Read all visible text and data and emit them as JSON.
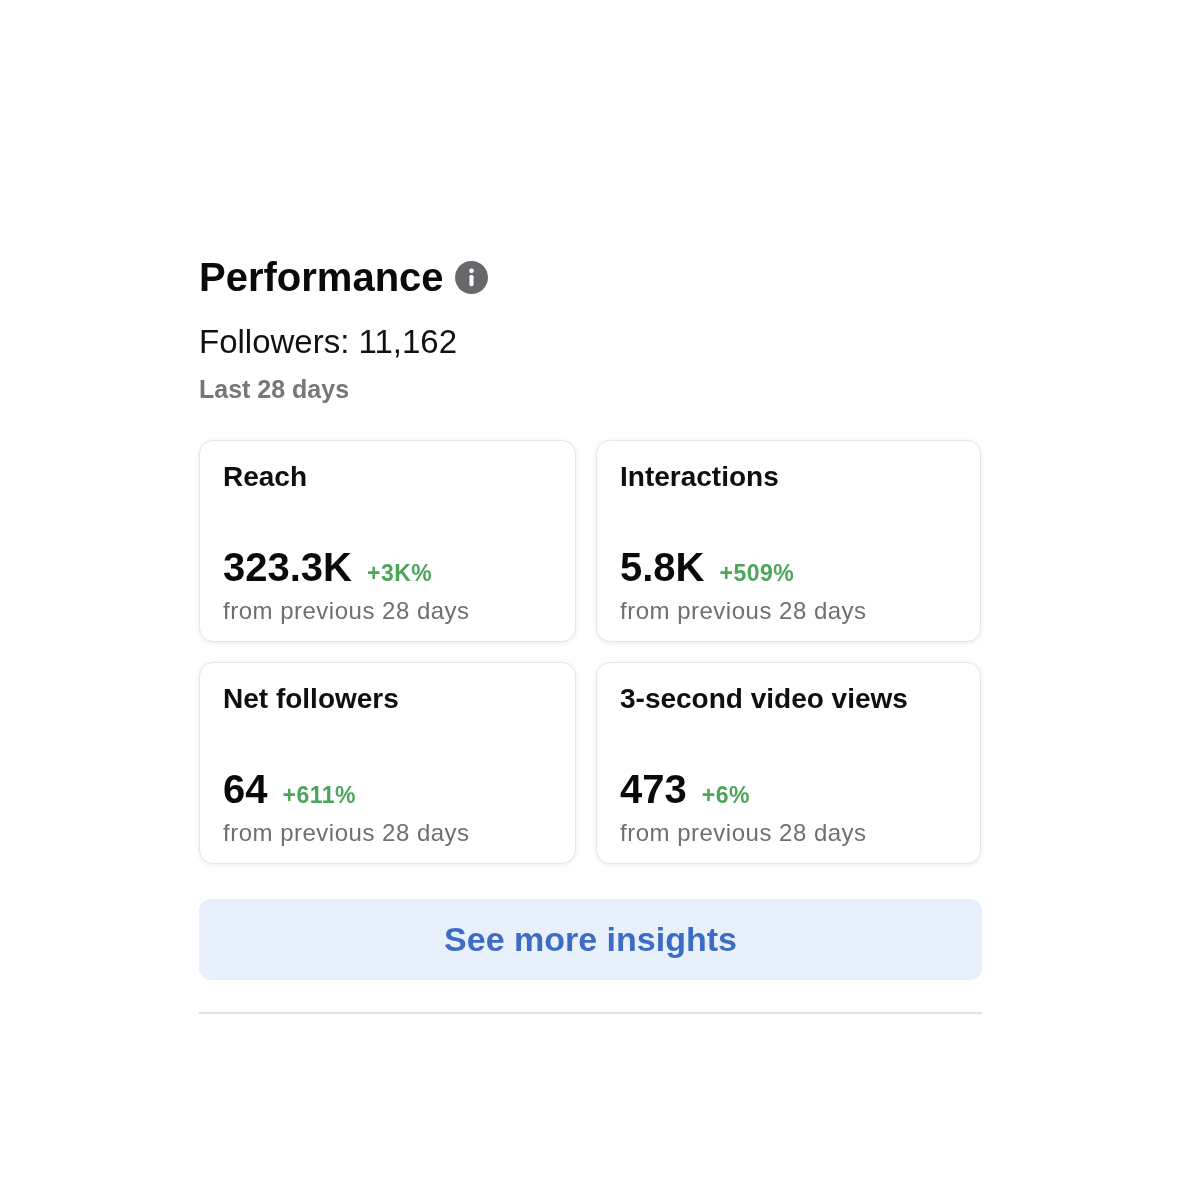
{
  "header": {
    "title": "Performance",
    "followers": "Followers: 11,162",
    "period": "Last 28 days"
  },
  "metrics": [
    {
      "label": "Reach",
      "value": "323.3K",
      "change": "+3K%",
      "comparison": "from previous 28 days"
    },
    {
      "label": "Interactions",
      "value": "5.8K",
      "change": "+509%",
      "comparison": "from previous 28 days"
    },
    {
      "label": "Net followers",
      "value": "64",
      "change": "+611%",
      "comparison": "from previous 28 days"
    },
    {
      "label": "3-second video views",
      "value": "473",
      "change": "+6%",
      "comparison": "from previous 28 days"
    }
  ],
  "button": {
    "label": "See more insights"
  }
}
